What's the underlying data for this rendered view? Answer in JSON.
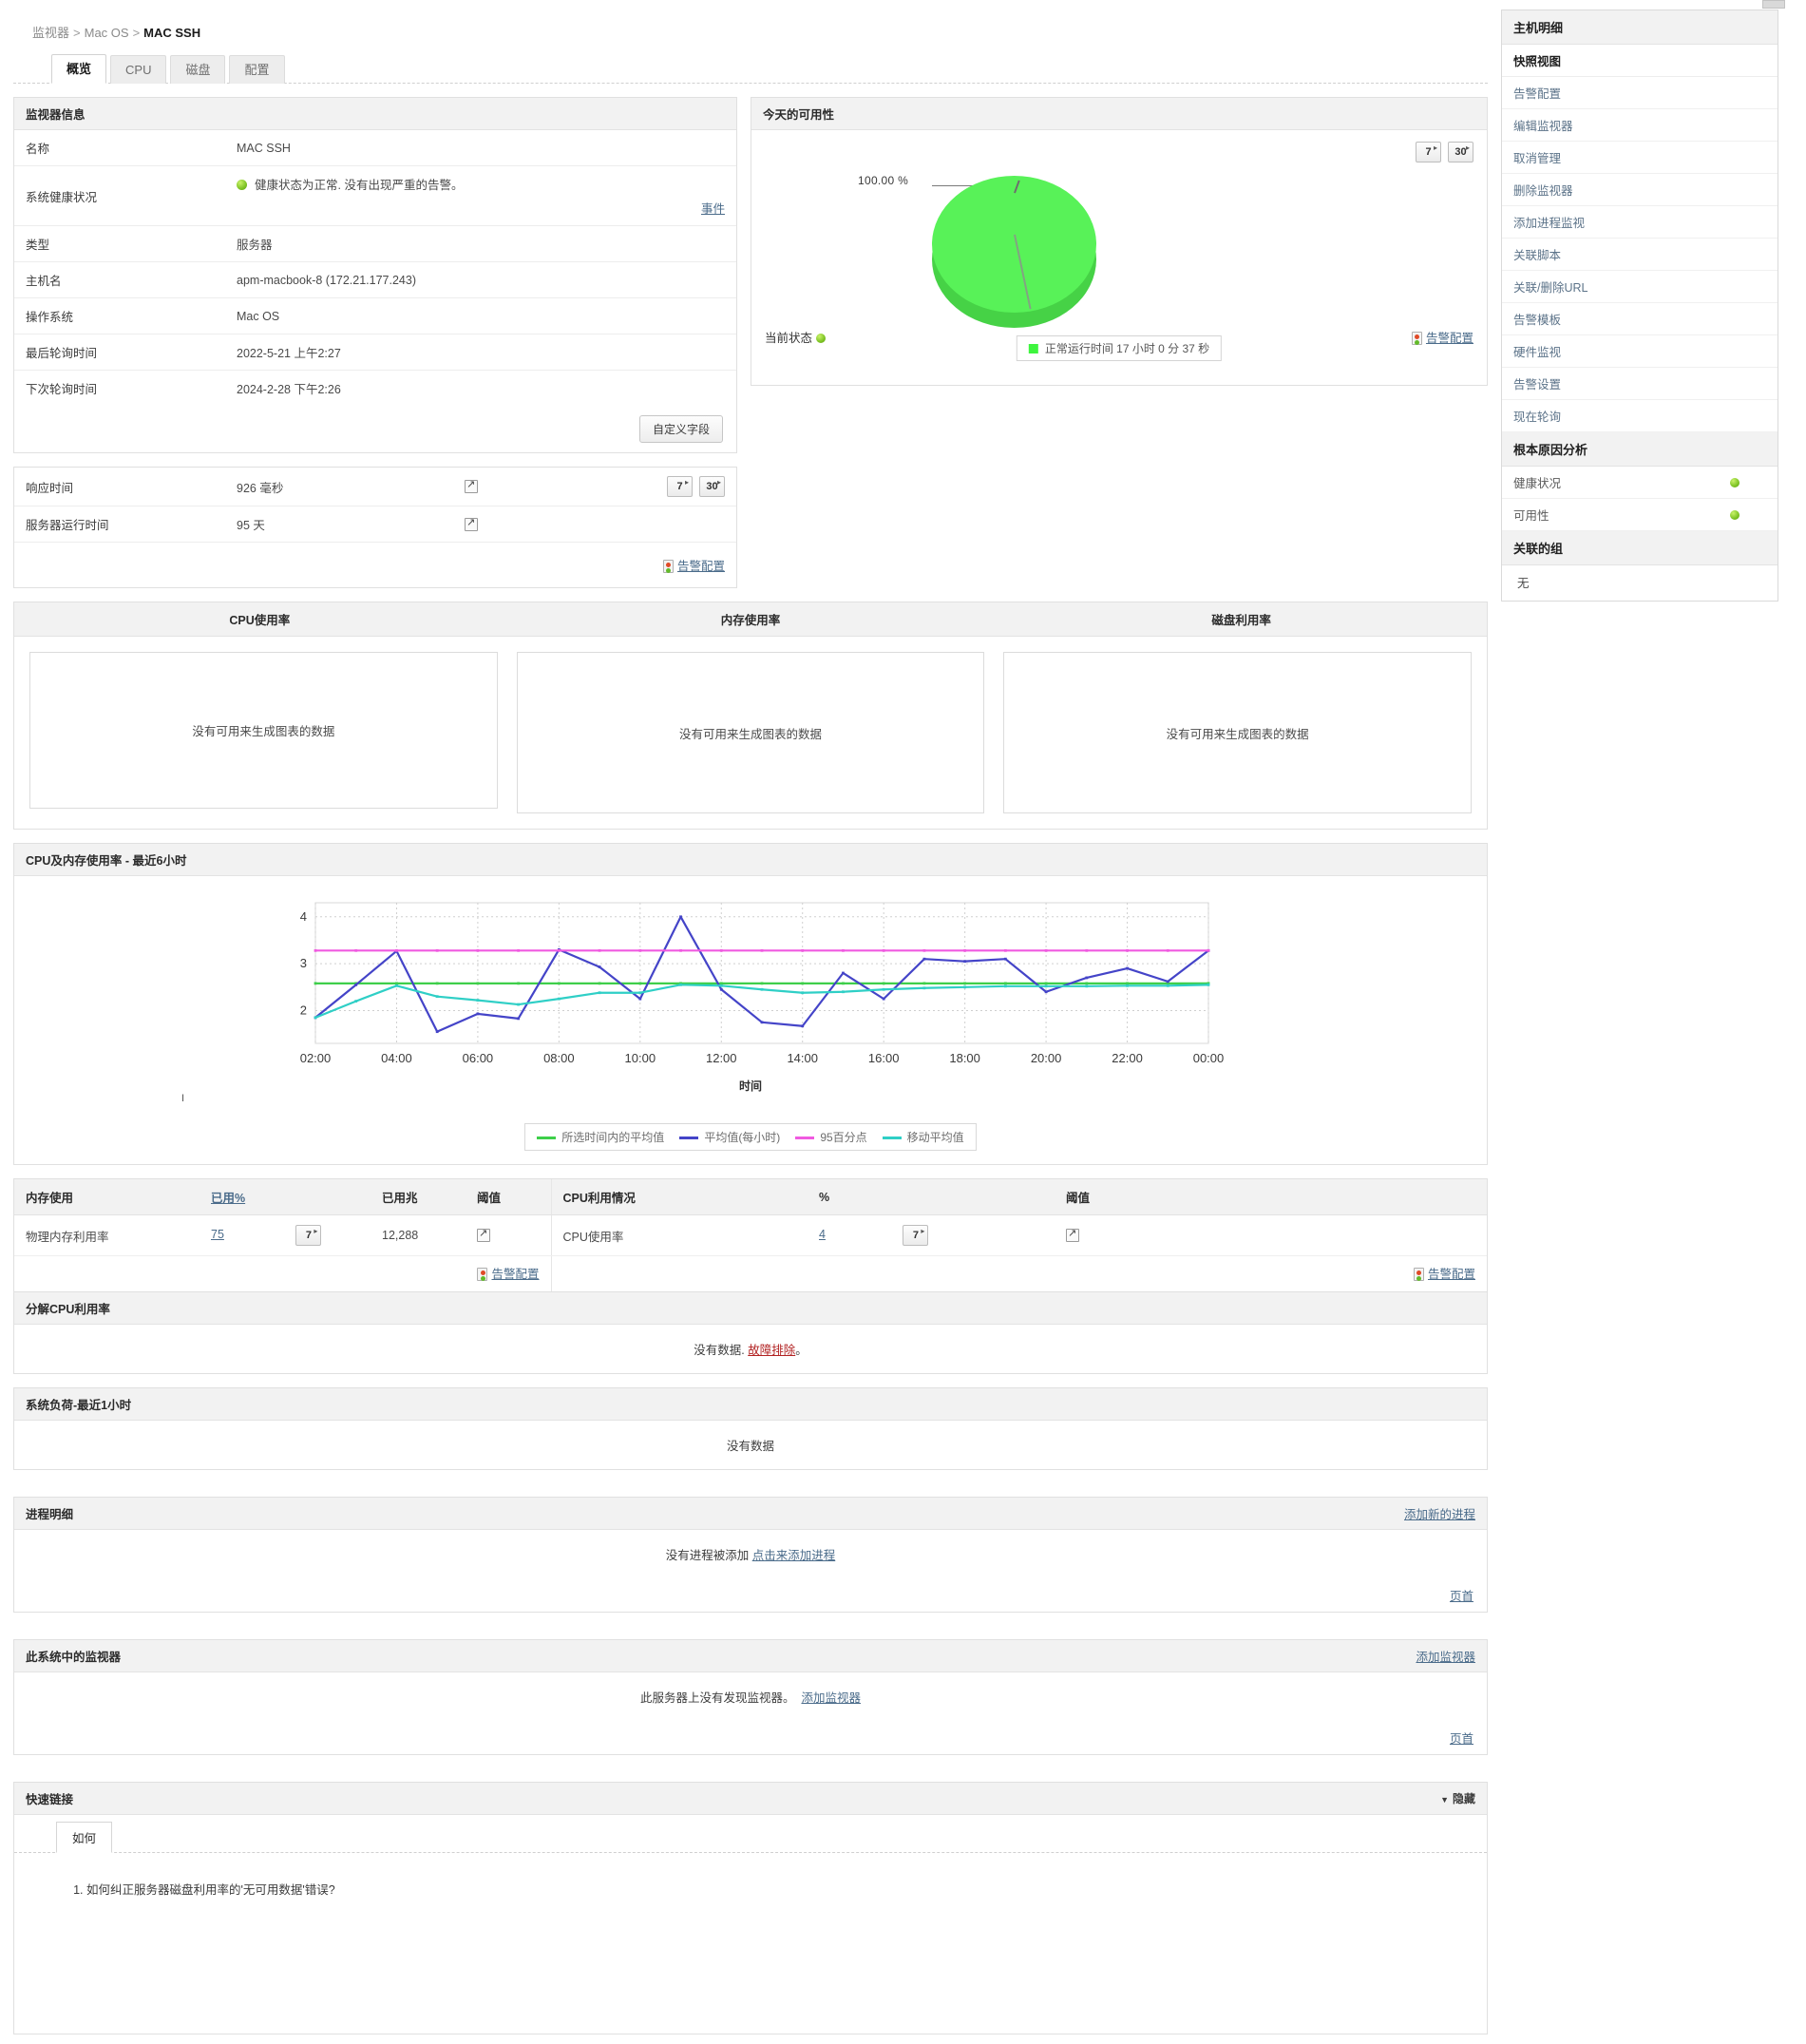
{
  "breadcrumb": {
    "root": "监视器",
    "middle": "Mac OS",
    "current": "MAC SSH",
    "separator": ">"
  },
  "tabs": [
    {
      "label": "概览",
      "active": true
    },
    {
      "label": "CPU",
      "active": false
    },
    {
      "label": "磁盘",
      "active": false
    },
    {
      "label": "配置",
      "active": false
    }
  ],
  "monitor_info": {
    "title": "监视器信息",
    "events_link": "事件",
    "custom_field_button": "自定义字段",
    "rows": [
      {
        "key": "名称",
        "value": "MAC SSH"
      },
      {
        "key": "系统健康状况",
        "value": "健康状态为正常. 没有出现严重的告警。"
      },
      {
        "key": "类型",
        "value": "服务器"
      },
      {
        "key": "主机名",
        "value": "apm-macbook-8 (172.21.177.243)"
      },
      {
        "key": "操作系统",
        "value": "Mac OS"
      },
      {
        "key": "最后轮询时间",
        "value": "2022-5-21 上午2:27"
      },
      {
        "key": "下次轮询时间",
        "value": "2024-2-28 下午2:26"
      }
    ]
  },
  "availability": {
    "title": "今天的可用性",
    "range_buttons": [
      "7",
      "30"
    ],
    "pie_label": "100.00 %",
    "legend": "正常运行时间 17 小时 0 分 37 秒",
    "current_status_label": "当前状态",
    "alarm_config_link": "告警配置",
    "chart_data": {
      "type": "pie",
      "title": "今天的可用性",
      "categories": [
        "正常运行时间"
      ],
      "values": [
        100.0
      ],
      "labels": [
        "100.00 %"
      ],
      "legend_entries": [
        "正常运行时间 17 小时 0 分 37 秒"
      ],
      "colors": [
        "#3ef53e"
      ],
      "legend_position": "bottom"
    }
  },
  "perf": {
    "range_buttons": [
      "7",
      "30"
    ],
    "alarm_config_link": "告警配置",
    "rows": [
      {
        "key": "响应时间",
        "value": "926 毫秒"
      },
      {
        "key": "服务器运行时间",
        "value": "95 天"
      }
    ]
  },
  "triple_charts": {
    "headers": [
      "CPU使用率",
      "内存使用率",
      "磁盘利用率"
    ],
    "empty_text": "没有可用来生成图表的数据"
  },
  "line_chart": {
    "title": "CPU及内存使用率 - 最近6小时",
    "stray_tick": "I",
    "chart_data": {
      "type": "line",
      "title": "CPU及内存使用率 - 最近6小时",
      "xlabel": "时间",
      "ylabel": "",
      "ylim": [
        1.3,
        4.3
      ],
      "yticks": [
        2,
        3,
        4
      ],
      "grid": true,
      "legend_position": "bottom",
      "x": [
        "02:00",
        "03:00",
        "04:00",
        "05:00",
        "06:00",
        "07:00",
        "08:00",
        "09:00",
        "10:00",
        "11:00",
        "12:00",
        "13:00",
        "14:00",
        "15:00",
        "16:00",
        "17:00",
        "18:00",
        "19:00",
        "20:00",
        "21:00",
        "22:00",
        "23:00",
        "00:00"
      ],
      "xticks": [
        "02:00",
        "04:00",
        "06:00",
        "08:00",
        "10:00",
        "12:00",
        "14:00",
        "16:00",
        "18:00",
        "20:00",
        "22:00",
        "00:00"
      ],
      "series": [
        {
          "name": "所选时间内的平均值",
          "color": "#3ecf4a",
          "values": [
            2.58,
            2.58,
            2.58,
            2.58,
            2.58,
            2.58,
            2.58,
            2.58,
            2.58,
            2.58,
            2.58,
            2.58,
            2.58,
            2.58,
            2.58,
            2.58,
            2.58,
            2.58,
            2.58,
            2.58,
            2.58,
            2.58,
            2.58
          ]
        },
        {
          "name": "平均值(每小时)",
          "color": "#4444c8",
          "values": [
            1.85,
            2.55,
            3.27,
            1.55,
            1.93,
            1.83,
            3.3,
            2.93,
            2.25,
            4.0,
            2.45,
            1.75,
            1.67,
            2.8,
            2.25,
            3.1,
            3.05,
            3.1,
            2.4,
            2.7,
            2.9,
            2.62,
            3.28
          ]
        },
        {
          "name": "95百分点",
          "color": "#f05ae0",
          "values": [
            3.28,
            3.28,
            3.28,
            3.28,
            3.28,
            3.28,
            3.28,
            3.28,
            3.28,
            3.28,
            3.28,
            3.28,
            3.28,
            3.28,
            3.28,
            3.28,
            3.28,
            3.28,
            3.28,
            3.28,
            3.28,
            3.28,
            3.28
          ]
        },
        {
          "name": "移动平均值",
          "color": "#2fcfc6",
          "values": [
            1.85,
            2.2,
            2.53,
            2.3,
            2.22,
            2.13,
            2.25,
            2.38,
            2.38,
            2.55,
            2.53,
            2.45,
            2.38,
            2.4,
            2.45,
            2.48,
            2.5,
            2.52,
            2.52,
            2.52,
            2.53,
            2.53,
            2.55
          ]
        }
      ]
    }
  },
  "usage_table": {
    "headers": [
      "内存使用",
      "已用%",
      "已用兆",
      "阈值",
      "CPU利用情况",
      "%",
      "阈值"
    ],
    "memory_row": {
      "name": "物理内存利用率",
      "used_pct": "75",
      "day_button": "7",
      "used_mb": "12,288"
    },
    "cpu_row": {
      "name": "CPU使用率",
      "pct": "4",
      "day_button": "7"
    },
    "alarm_config_link": "告警配置"
  },
  "cpu_breakdown": {
    "title": "分解CPU利用率",
    "message_prefix": "没有数据.",
    "link": "故障排除",
    "message_suffix": "。"
  },
  "system_load": {
    "title": "系统负荷-最近1小时",
    "message": "没有数据"
  },
  "process_detail": {
    "title": "进程明细",
    "add_link": "添加新的进程",
    "message": "没有进程被添加",
    "inline_link": "点击来添加进程",
    "top_link": "页首"
  },
  "system_monitors": {
    "title": "此系统中的监视器",
    "add_link": "添加监视器",
    "message": "此服务器上没有发现监视器。",
    "inline_link": "添加监视器",
    "top_link": "页首"
  },
  "quick_links": {
    "title": "快速链接",
    "hide_label": "隐藏",
    "tab_label": "如何",
    "items": [
      "如何纠正服务器磁盘利用率的'无可用数据'错误?"
    ]
  },
  "sidebar": {
    "title": "主机明细",
    "snapshot_label": "快照视图",
    "items": [
      "告警配置",
      "编辑监视器",
      "取消管理",
      "删除监视器",
      "添加进程监视",
      "关联脚本",
      "关联/删除URL",
      "告警模板",
      "硬件监视",
      "告警设置",
      "现在轮询"
    ],
    "rca_title": "根本原因分析",
    "rca_rows": [
      {
        "label": "健康状况",
        "status": "ok"
      },
      {
        "label": "可用性",
        "status": "ok"
      }
    ],
    "groups_title": "关联的组",
    "groups_value": "无"
  },
  "colors": {
    "accent_green": "#63ba2a",
    "link": "#4a6b8a",
    "pie_green": "#3ef53e",
    "series_avg": "#3ecf4a",
    "series_hourly": "#4444c8",
    "series_p95": "#f05ae0",
    "series_moving": "#2fcfc6"
  }
}
